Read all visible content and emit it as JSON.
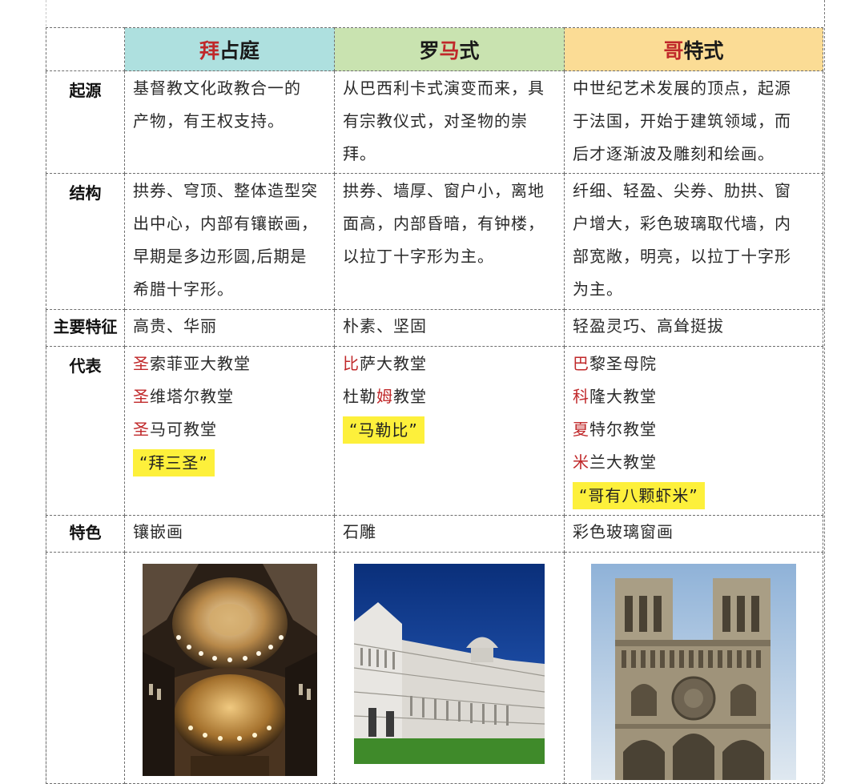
{
  "headers": [
    {
      "first": "拜",
      "rest": "占庭"
    },
    {
      "first": "罗",
      "mid": "马",
      "rest": "式"
    },
    {
      "first": "哥",
      "rest": "特式"
    }
  ],
  "rows": {
    "origin": {
      "label": "起源",
      "byz": [
        "基督教文化政教合一的",
        "产物，有王权支持。"
      ],
      "rom": [
        "从巴西利卡式演变而来，具",
        "有宗教仪式，对圣物的崇",
        "拜。"
      ],
      "got": [
        "中世纪艺术发展的顶点，起源",
        "于法国，开始于建筑领域，而",
        "后才逐渐波及雕刻和绘画。"
      ]
    },
    "structure": {
      "label": "结构",
      "byz": [
        "拱券、穹顶、整体造型突",
        "出中心，内部有镶嵌画，",
        "早期是多边形圆,后期是",
        "希腊十字形。"
      ],
      "rom": [
        "拱券、墙厚、窗户小，离地",
        "面高，内部昏暗，有钟楼，",
        "以拉丁十字形为主。"
      ],
      "got": [
        "纤细、轻盈、尖券、肋拱、窗",
        "户增大，彩色玻璃取代墙，内",
        "部宽敞，明亮，以拉丁十字形",
        "为主。"
      ]
    },
    "features": {
      "label": "主要特征",
      "byz": "高贵、华丽",
      "rom": "朴素、坚固",
      "got": "轻盈灵巧、高耸挺拔"
    },
    "examples": {
      "label": "代表",
      "byz": [
        {
          "first": "圣",
          "rest": "索菲亚大教堂"
        },
        {
          "first": "圣",
          "rest": "维塔尔教堂"
        },
        {
          "first": "圣",
          "rest": "马可教堂"
        }
      ],
      "byz_mnemonic": "“拜三圣”",
      "rom": [
        {
          "first": "比",
          "rest": "萨大教堂"
        },
        {
          "pre": "杜勒",
          "first": "姆",
          "rest": "教堂"
        }
      ],
      "rom_mnemonic": "“马勒比”",
      "got": [
        {
          "first": "巴",
          "rest": "黎圣母院"
        },
        {
          "first": "科",
          "rest": "隆大教堂"
        },
        {
          "first": "夏",
          "rest": "特尔教堂"
        },
        {
          "first": "米",
          "rest": "兰大教堂"
        }
      ],
      "got_mnemonic": "“哥有八颗虾米”"
    },
    "specialty": {
      "label": "特色",
      "byz": "镶嵌画",
      "rom": "石雕",
      "got": "彩色玻璃窗画"
    }
  },
  "colors": {
    "header_byzantine": "#aee0df",
    "header_romanesque": "#c9e3b0",
    "header_gothic": "#fbdc95",
    "highlight": "#fdf03b",
    "accent_red": "#c0282a"
  }
}
